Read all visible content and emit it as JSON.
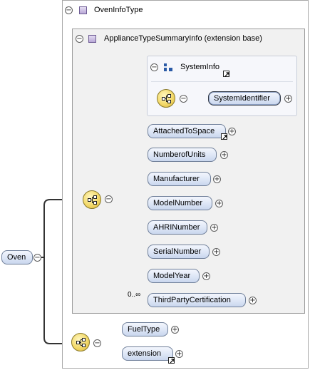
{
  "root_element": {
    "label": "Oven"
  },
  "complex_type": {
    "title": "OvenInfoType"
  },
  "extension": {
    "title": "ApplianceTypeSummaryInfo (extension base)"
  },
  "group": {
    "title": "SystemInfo"
  },
  "group_elements": [
    {
      "label": "SystemIdentifier"
    }
  ],
  "base_elements": [
    {
      "label": "AttachedToSpace"
    },
    {
      "label": "NumberofUnits"
    },
    {
      "label": "Manufacturer"
    },
    {
      "label": "ModelNumber"
    },
    {
      "label": "AHRINumber"
    },
    {
      "label": "SerialNumber"
    },
    {
      "label": "ModelYear"
    },
    {
      "label": "ThirdPartyCertification",
      "occurrence": "0..∞"
    }
  ],
  "type_elements": [
    {
      "label": "FuelType"
    },
    {
      "label": "extension"
    }
  ],
  "glyphs": {
    "collapse": "−",
    "expand": "+"
  },
  "icons": {
    "type": "complex-type-icon",
    "extension": "complex-type-icon",
    "group": "group-icon",
    "sequence": "sequence-compositor-icon",
    "reference": "reference-arrow-icon"
  },
  "colors": {
    "element_fill": "#dde6f6",
    "element_border": "#6f7f99",
    "compositor_fill": "#f3d96a",
    "type_icon": "#b9a8d6",
    "group_icon": "#2a5aa6"
  }
}
